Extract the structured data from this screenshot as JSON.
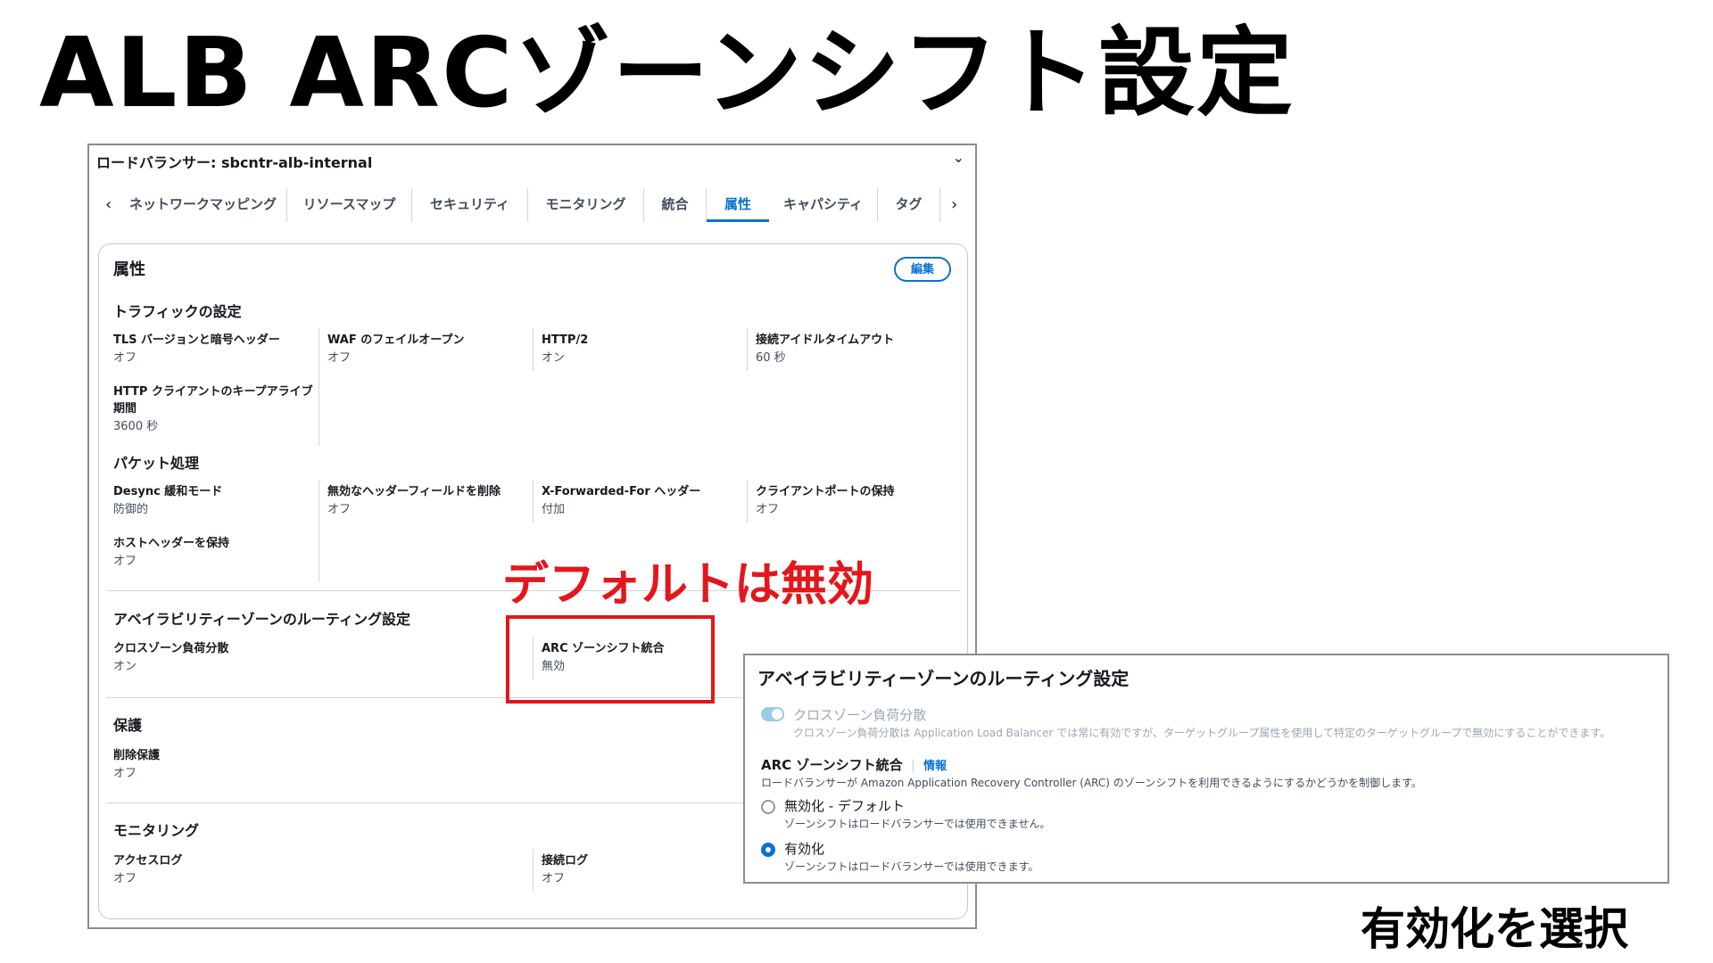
{
  "slide": {
    "title": "ALB  ARCゾーンシフト設定",
    "annotation": "デフォルトは無効",
    "bottom_note": "有効化を選択"
  },
  "console": {
    "load_balancer_title": "ロードバランサー: sbcntr-alb-internal",
    "collapse_icon": "chevron-down-icon",
    "tabs": [
      {
        "label": "ネットワークマッピング"
      },
      {
        "label": "リソースマップ"
      },
      {
        "label": "セキュリティ"
      },
      {
        "label": "モニタリング"
      },
      {
        "label": "統合"
      },
      {
        "label": "属性",
        "active": true
      },
      {
        "label": "キャパシティ"
      },
      {
        "label": "タグ"
      }
    ],
    "attributes": {
      "title": "属性",
      "edit_label": "編集",
      "traffic": {
        "title": "トラフィックの設定",
        "items": [
          {
            "key": "TLS バージョンと暗号ヘッダー",
            "value": "オフ"
          },
          {
            "key": "WAF のフェイルオープン",
            "value": "オフ"
          },
          {
            "key": "HTTP/2",
            "value": "オン"
          },
          {
            "key": "接続アイドルタイムアウト",
            "value": "60 秒"
          },
          {
            "key": "HTTP クライアントのキープアライブ期間",
            "value": "3600 秒"
          }
        ]
      },
      "packet": {
        "title": "パケット処理",
        "items": [
          {
            "key": "Desync 緩和モード",
            "value": "防御的"
          },
          {
            "key": "無効なヘッダーフィールドを削除",
            "value": "オフ"
          },
          {
            "key": "X-Forwarded-For ヘッダー",
            "value": "付加"
          },
          {
            "key": "クライアントポートの保持",
            "value": "オフ"
          },
          {
            "key": "ホストヘッダーを保持",
            "value": "オフ"
          }
        ]
      },
      "az_routing": {
        "title": "アベイラビリティーゾーンのルーティング設定",
        "items": [
          {
            "key": "クロスゾーン負荷分散",
            "value": "オン"
          },
          {
            "key": "ARC ゾーンシフト統合",
            "value": "無効"
          }
        ]
      },
      "protection": {
        "title": "保護",
        "items": [
          {
            "key": "削除保護",
            "value": "オフ"
          }
        ]
      },
      "monitoring": {
        "title": "モニタリング",
        "items": [
          {
            "key": "アクセスログ",
            "value": "オフ"
          },
          {
            "key": "接続ログ",
            "value": "オフ"
          }
        ]
      }
    }
  },
  "overlay": {
    "title": "アベイラビリティーゾーンのルーティング設定",
    "cross_zone": {
      "label": "クロスゾーン負荷分散",
      "description": "クロスゾーン負荷分散は Application Load Balancer では常に有効ですが、ターゲットグループ属性を使用して特定のターゲットグループで無効にすることができます。"
    },
    "arc": {
      "label": "ARC ゾーンシフト統合",
      "info_link": "情報",
      "description": "ロードバランサーが Amazon Application Recovery Controller (ARC) のゾーンシフトを利用できるようにするかどうかを制御します。",
      "options": [
        {
          "label": "無効化 - デフォルト",
          "description": "ゾーンシフトはロードバランサーでは使用できません。",
          "selected": false
        },
        {
          "label": "有効化",
          "description": "ゾーンシフトはロードバランサーでは使用できます。",
          "selected": true
        }
      ]
    }
  }
}
